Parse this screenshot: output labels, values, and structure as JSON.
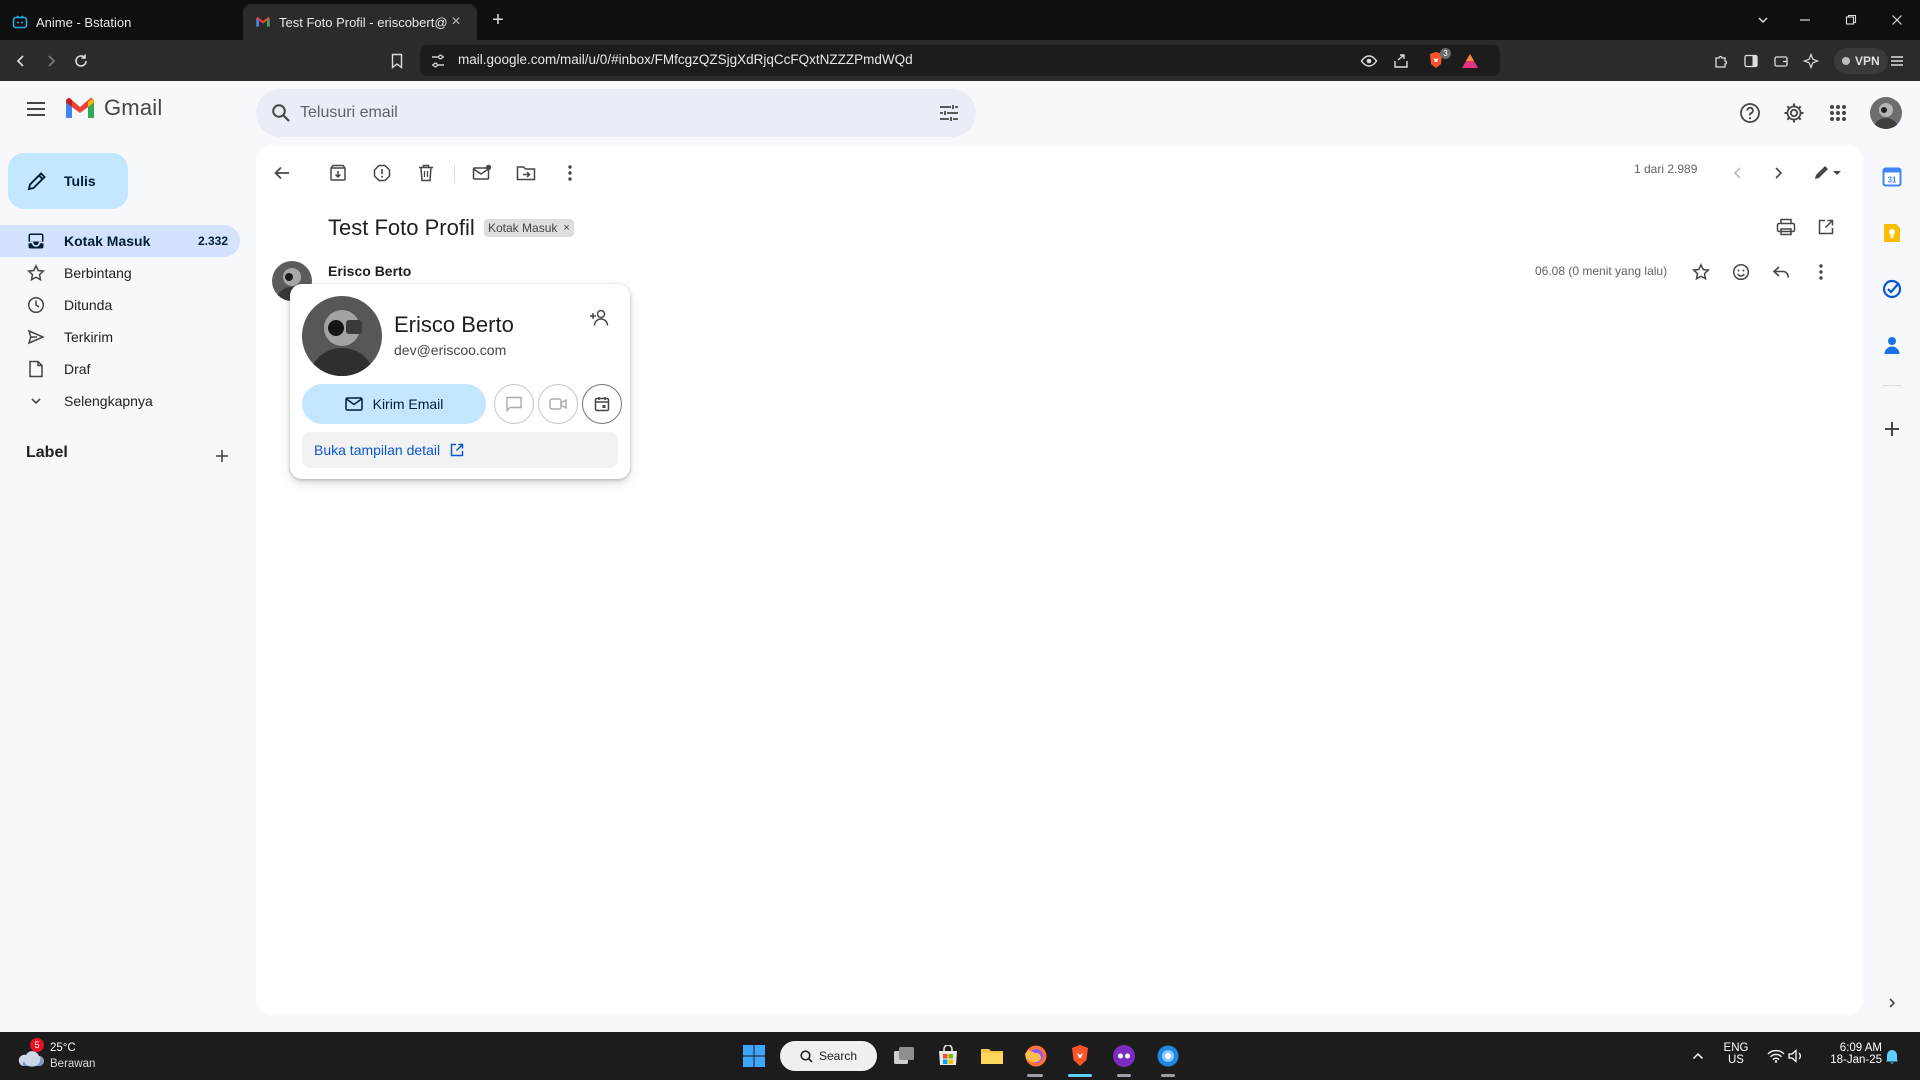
{
  "browser": {
    "tabs": [
      {
        "title": "Anime - Bstation"
      },
      {
        "title": "Test Foto Profil - eriscobert@gma"
      }
    ],
    "url": "mail.google.com/mail/u/0/#inbox/FMfcgzQZSjgXdRjqCcFQxtNZZZPmdWQd",
    "vpn_label": "VPN",
    "shield_badge": "3"
  },
  "gmail": {
    "logo_text": "Gmail",
    "search_placeholder": "Telusuri email",
    "compose_label": "Tulis",
    "nav": [
      {
        "label": "Kotak Masuk",
        "count": "2.332",
        "icon": "inbox-icon"
      },
      {
        "label": "Berbintang",
        "icon": "star-icon"
      },
      {
        "label": "Ditunda",
        "icon": "clock-icon"
      },
      {
        "label": "Terkirim",
        "icon": "send-icon"
      },
      {
        "label": "Draf",
        "icon": "draft-icon"
      },
      {
        "label": "Selengkapnya",
        "icon": "chevron-down-icon"
      }
    ],
    "labels_heading": "Label",
    "pager": "1 dari 2.989",
    "subject": "Test Foto Profil",
    "chip": "Kotak Masuk",
    "sender": "Erisco Berto",
    "time": "06.08 (0 menit yang lalu)"
  },
  "hovercard": {
    "name": "Erisco Berto",
    "email": "dev@eriscoo.com",
    "send_email_label": "Kirim Email",
    "detail_link": "Buka tampilan detail"
  },
  "taskbar": {
    "weather_badge": "5",
    "temp": "25°C",
    "condition": "Berawan",
    "search_label": "Search",
    "lang_line1": "ENG",
    "lang_line2": "US",
    "clock_time": "6:09 AM",
    "clock_date": "18-Jan-25"
  },
  "colors": {
    "compose_bg": "#c2e7ff",
    "active_nav_bg": "#d3e3fd",
    "link_blue": "#0b57d0",
    "gmail_red": "#ea4335"
  }
}
